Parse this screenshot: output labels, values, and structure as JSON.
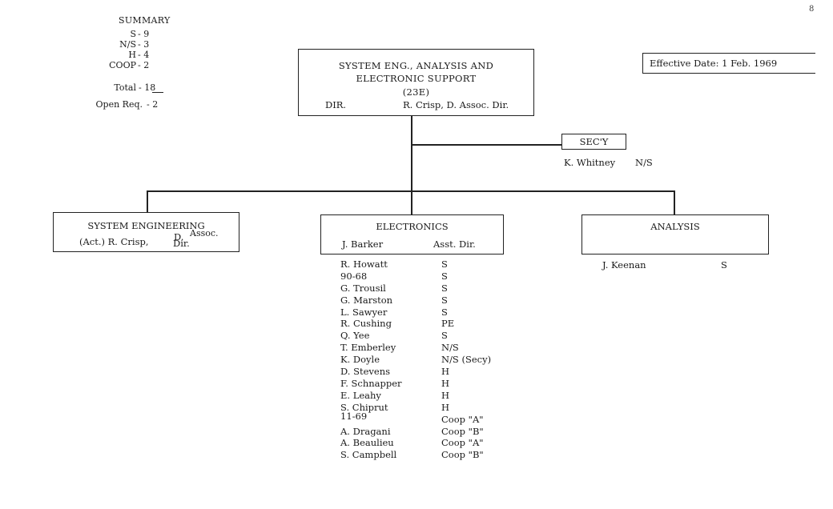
{
  "page_number": "8",
  "summary": {
    "title": "SUMMARY",
    "rows": [
      {
        "key": "S",
        "value": "- 9"
      },
      {
        "key": "N/S",
        "value": "- 3"
      },
      {
        "key": "H",
        "value": "- 4"
      },
      {
        "key": "COOP",
        "value": "- 2"
      }
    ],
    "total": {
      "key": "Total",
      "value": "- 18"
    },
    "open_req": {
      "key": "Open Req.",
      "value": "- 2"
    }
  },
  "effective_date": "Effective Date:  1 Feb. 1969",
  "top_unit": {
    "title_line1": "SYSTEM ENG., ANALYSIS AND",
    "title_line2": "ELECTRONIC SUPPORT",
    "code": "(23E)",
    "dir_label": "DIR.",
    "director": "R. Crisp, D. Assoc. Dir."
  },
  "secretary": {
    "label": "SEC'Y",
    "name": "K. Whitney",
    "status": "N/S"
  },
  "departments": {
    "system_engineering": {
      "title": "SYSTEM ENGINEERING",
      "lead": "(Act.) R. Crisp,",
      "role_top": "D.",
      "role_sup": "Assoc.",
      "role_bottom": "Dir."
    },
    "electronics": {
      "title": "ELECTRONICS",
      "lead": "J. Barker",
      "role": "Asst. Dir.",
      "staff": [
        {
          "name": "R. Howatt",
          "status": "S"
        },
        {
          "name": "90-68",
          "status": "S"
        },
        {
          "name": "G. Trousil",
          "status": "S"
        },
        {
          "name": "G. Marston",
          "status": "S"
        },
        {
          "name": "L. Sawyer",
          "status": "S"
        },
        {
          "name": "R. Cushing",
          "status": "PE"
        },
        {
          "name": "Q. Yee",
          "status": "S"
        },
        {
          "name": "T. Emberley",
          "status": "N/S"
        },
        {
          "name": "K. Doyle",
          "status": "N/S (Secy)"
        },
        {
          "name": "D. Stevens",
          "status": "H"
        },
        {
          "name": "F. Schnapper",
          "status": "H"
        },
        {
          "name": "E. Leahy",
          "status": "H"
        },
        {
          "name": "S. Chiprut",
          "status": "H"
        },
        {
          "name": "11-69",
          "status": "Coop \"A\""
        },
        {
          "name": "A. Dragani",
          "status": "Coop \"B\""
        },
        {
          "name": "A. Beaulieu",
          "status": "Coop \"A\""
        },
        {
          "name": "S. Campbell",
          "status": "Coop \"B\""
        }
      ]
    },
    "analysis": {
      "title": "ANALYSIS",
      "staff": [
        {
          "name": "J. Keenan",
          "status": "S"
        }
      ]
    }
  }
}
